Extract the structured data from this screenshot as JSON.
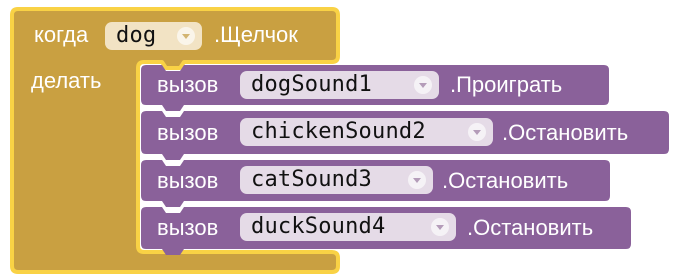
{
  "event_block": {
    "when_label": "когда",
    "component": "dog",
    "event_name": ".Щелчок",
    "do_label": "делать",
    "color": "#c9a041",
    "highlight_color": "#f9d245"
  },
  "call_blocks": [
    {
      "call_label": "вызов",
      "component": "dogSound1",
      "method": ".Проиграть"
    },
    {
      "call_label": "вызов",
      "component": "chickenSound2",
      "method": ".Остановить"
    },
    {
      "call_label": "вызов",
      "component": "catSound3",
      "method": ".Остановить"
    },
    {
      "call_label": "вызов",
      "component": "duckSound4",
      "method": ".Остановить"
    }
  ],
  "colors": {
    "call_block": "#8a619a",
    "call_field": "#e5dbe7",
    "event_field": "#f2e3c4"
  },
  "icons": {
    "dropdown": "chevron-down-icon"
  }
}
